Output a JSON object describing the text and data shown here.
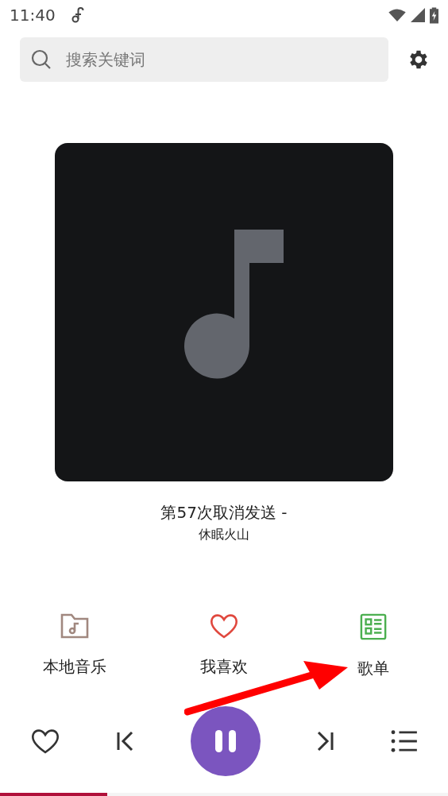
{
  "status_bar": {
    "time": "11:40"
  },
  "search": {
    "placeholder": "搜索关键词"
  },
  "now_playing": {
    "title": "第57次取消发送 -",
    "artist": "休眠火山",
    "artwork": {
      "kind": "music-note"
    }
  },
  "shortcuts": [
    {
      "kind": "folder",
      "label": "本地音乐",
      "color": "#a1887f"
    },
    {
      "kind": "heart",
      "label": "我喜欢",
      "color": "#e0483e"
    },
    {
      "kind": "playlist",
      "label": "歌单",
      "color": "#4caf50"
    }
  ],
  "controls": [
    {
      "kind": "favorite"
    },
    {
      "kind": "previous"
    },
    {
      "kind": "pause"
    },
    {
      "kind": "next"
    },
    {
      "kind": "queue"
    }
  ],
  "progress": {
    "level": 0.24
  },
  "annotation": {
    "kind": "arrow"
  }
}
